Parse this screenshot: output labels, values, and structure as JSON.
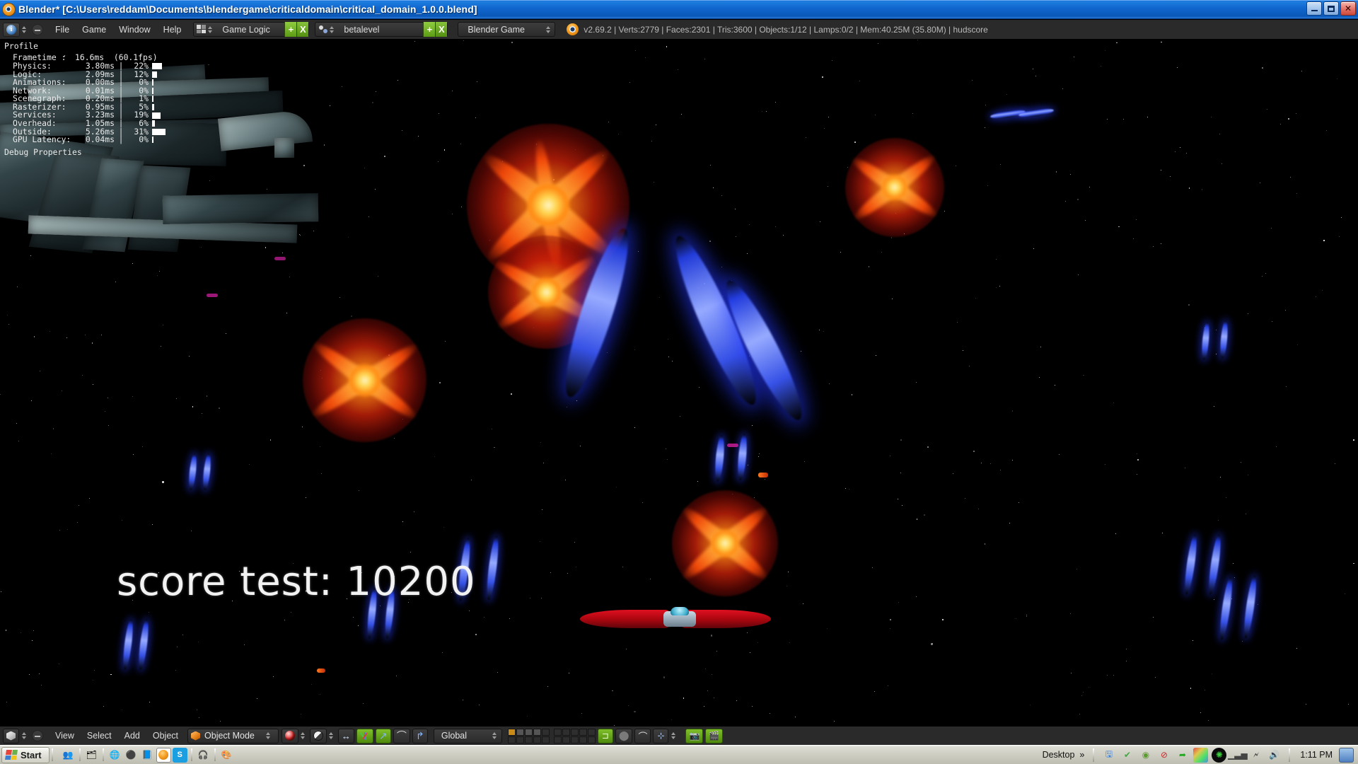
{
  "window": {
    "title": "Blender* [C:\\Users\\reddam\\Documents\\blendergame\\criticaldomain\\critical_domain_1.0.0.blend]",
    "app_icon": "blender-logo-icon",
    "minimize_label": "Minimize",
    "maximize_label": "Maximize",
    "close_label": "Close"
  },
  "header": {
    "editor_type_icon": "info-editor-icon",
    "menus": [
      "File",
      "Game",
      "Window",
      "Help"
    ],
    "screen_layout": {
      "icon": "screen-layout-icon",
      "value": "Game Logic",
      "add_label": "+",
      "delete_label": "X"
    },
    "scene": {
      "icon": "scene-icon",
      "value": "betalevel",
      "add_label": "+",
      "delete_label": "X"
    },
    "engine": {
      "value": "Blender Game"
    },
    "stats": "v2.69.2 | Verts:2779 | Faces:2301 | Tris:3600 | Objects:1/12 | Lamps:0/2 | Mem:40.25M (35.80M) | hudscore"
  },
  "profile": {
    "title": "Profile",
    "frametime_label": "Frametime :",
    "frametime_value": "16.6ms  (60.1fps)",
    "rows": [
      {
        "name": "Physics:",
        "time": "3.80ms",
        "sep": "|",
        "pct": "22%",
        "bar": 22
      },
      {
        "name": "Logic:",
        "time": "2.09ms",
        "sep": "|",
        "pct": "12%",
        "bar": 12
      },
      {
        "name": "Animations:",
        "time": "0.00ms",
        "sep": "|",
        "pct": "0%",
        "bar": 0
      },
      {
        "name": "Network:",
        "time": "0.01ms",
        "sep": "|",
        "pct": "0%",
        "bar": 0
      },
      {
        "name": "Scenegraph:",
        "time": "0.20ms",
        "sep": "|",
        "pct": "1%",
        "bar": 1
      },
      {
        "name": "Rasterizer:",
        "time": "0.95ms",
        "sep": "|",
        "pct": "5%",
        "bar": 5
      },
      {
        "name": "Services:",
        "time": "3.23ms",
        "sep": "|",
        "pct": "19%",
        "bar": 19
      },
      {
        "name": "Overhead:",
        "time": "1.05ms",
        "sep": "|",
        "pct": "6%",
        "bar": 6
      },
      {
        "name": "Outside:",
        "time": "5.26ms",
        "sep": "|",
        "pct": "31%",
        "bar": 31
      },
      {
        "name": "GPU Latency:",
        "time": "0.04ms",
        "sep": "|",
        "pct": "0%",
        "bar": 0
      }
    ],
    "debug_properties_label": "Debug Properties"
  },
  "game": {
    "hud_score_text": "score test: 10200",
    "score_value": 10200,
    "score_label": "score test:"
  },
  "footer": {
    "editor_icon": "3d-view-editor-icon",
    "menus": [
      "View",
      "Select",
      "Add",
      "Object"
    ],
    "mode": {
      "icon": "object-mode-icon",
      "value": "Object Mode"
    },
    "viewport_shading_icon": "material-shading-icon",
    "pivot_icon": "pivot-point-icon",
    "manipulator_toggle_icon": "manipulator-icon",
    "translate_icon": "translate-manipulator-icon",
    "rotate_icon": "rotate-manipulator-icon",
    "scale_icon": "scale-manipulator-icon",
    "orientation": {
      "value": "Global"
    },
    "layers_label": "Scene layers",
    "render_icon": "render-camera-icon",
    "animation_icon": "render-animation-icon",
    "snap_icon": "snap-magnet-icon",
    "proportional_icon": "proportional-edit-icon",
    "render_shading_icon": "viewport-shading-icon"
  },
  "taskbar": {
    "start_label": "Start",
    "quick_launch": [
      {
        "name": "user-accounts-icon",
        "glyph": "👥"
      },
      {
        "name": "file-explorer-icon",
        "glyph": "🗂"
      },
      {
        "name": "firefox-icon",
        "glyph": "🌐"
      },
      {
        "name": "media-player-icon",
        "glyph": "⚫"
      },
      {
        "name": "notepad-icon",
        "glyph": "📘"
      },
      {
        "name": "blender-icon",
        "glyph": "◉",
        "active": true
      },
      {
        "name": "skype-icon",
        "glyph": "S"
      },
      {
        "name": "headphones-icon",
        "glyph": "🎧"
      },
      {
        "name": "paint-icon",
        "glyph": "🎨"
      }
    ],
    "desktop_label": "Desktop",
    "overflow_label": "»",
    "tray": [
      {
        "name": "windows-update-icon"
      },
      {
        "name": "antivirus-shield-icon"
      },
      {
        "name": "nvidia-icon"
      },
      {
        "name": "display-blocked-icon"
      },
      {
        "name": "green-arrow-icon"
      },
      {
        "name": "color-grid-icon"
      },
      {
        "name": "spiral-icon"
      },
      {
        "name": "signal-bars-icon"
      },
      {
        "name": "battery-icon"
      },
      {
        "name": "volume-icon"
      }
    ],
    "clock": "1:11 PM",
    "show-desktop": "show-desktop-icon"
  },
  "colors": {
    "titlebar_blue": "#1168cf",
    "blender_gray": "#2a2a2a",
    "accent_green": "#6fae1f",
    "explosion_orange": "#ff7a14",
    "laser_blue": "#2c46ff",
    "ship_red": "#c0101f",
    "taskbar_gray": "#cfcfc4"
  }
}
